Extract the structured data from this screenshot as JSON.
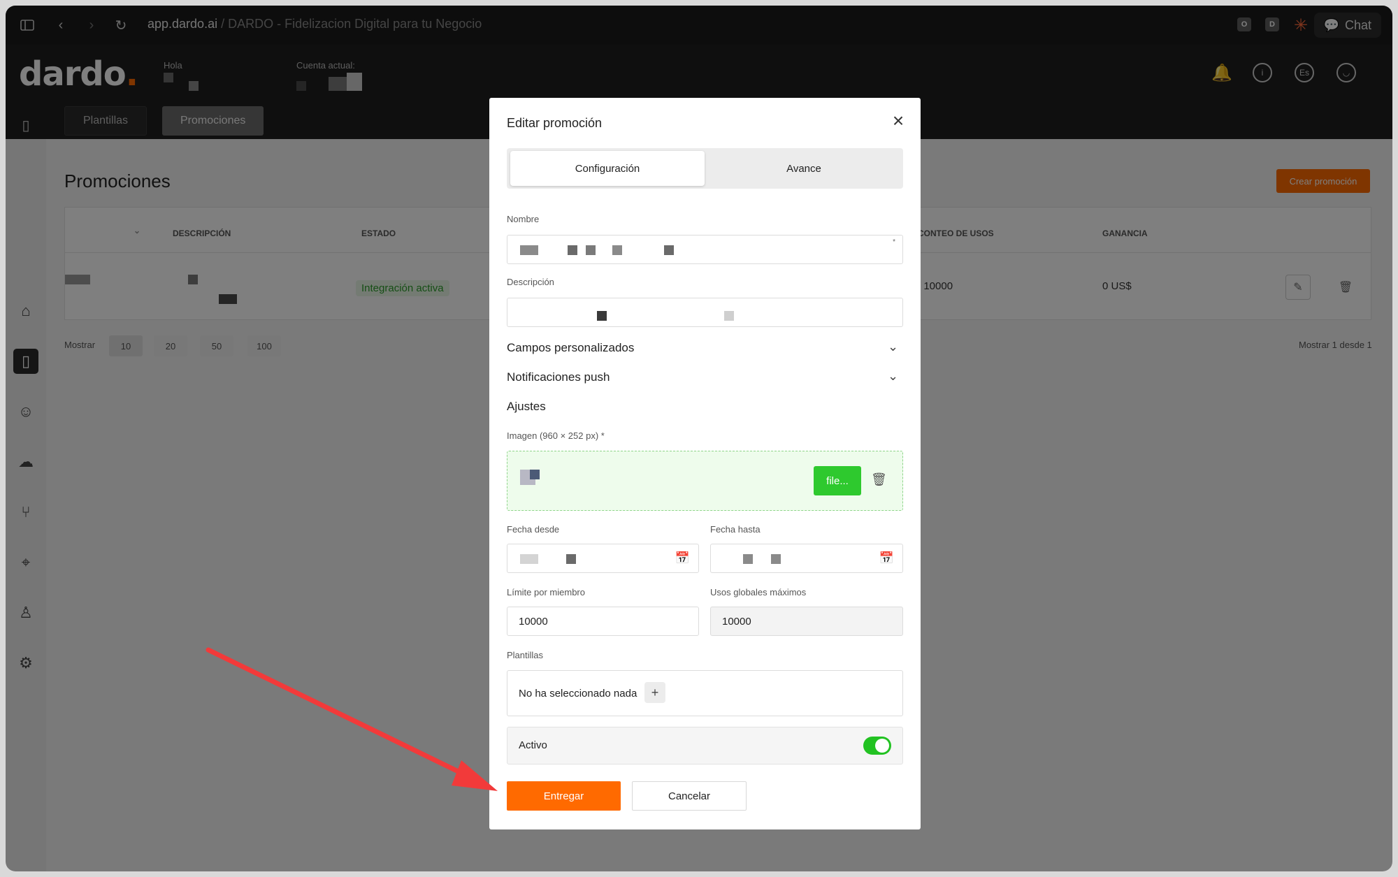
{
  "browser": {
    "url_host": "app.dardo.ai",
    "url_separator": " / ",
    "page_title": "DARDO - Fidelizacion Digital para tu Negocio",
    "ext_o": "O",
    "ext_d": "D",
    "chat_label": "Chat"
  },
  "header": {
    "logo_text": "dardo",
    "logo_dot": ".",
    "greeting_label": "Hola",
    "account_label": "Cuenta actual:",
    "nav": [
      "Plantillas",
      "Promociones"
    ],
    "lang_badge": "Es"
  },
  "page": {
    "title": "Promociones",
    "create_button": "Crear promoción",
    "columns": [
      "Descripción",
      "Estado",
      "Conteo de usos",
      "Ganancia"
    ],
    "row": {
      "status": "Integración activa",
      "usage_count": "/ 10000",
      "earnings": "0 US$"
    },
    "pager_label": "Mostrar",
    "page_sizes": [
      "10",
      "20",
      "50",
      "100"
    ],
    "pager_summary": "Mostrar 1 desde 1"
  },
  "modal": {
    "title": "Editar promoción",
    "tabs": [
      "Configuración",
      "Avance"
    ],
    "name_label": "Nombre",
    "description_label": "Descripción",
    "custom_fields_label": "Campos personalizados",
    "push_label": "Notificaciones push",
    "settings_label": "Ajustes",
    "image_label": "Imagen (960 × 252 px) *",
    "file_button": "file...",
    "date_from_label": "Fecha desde",
    "date_to_label": "Fecha hasta",
    "limit_label": "Límite por miembro",
    "limit_value": "10000",
    "global_label": "Usos globales máximos",
    "global_value": "10000",
    "templates_label": "Plantillas",
    "templates_empty": "No ha seleccionado nada",
    "add_template": "+",
    "active_label": "Activo",
    "active_on": true,
    "submit_button": "Entregar",
    "cancel_button": "Cancelar",
    "required_mark": "*"
  },
  "colors": {
    "accent": "#ff6a00",
    "success": "#2ec92e",
    "header_bg": "#1f1f1f"
  }
}
